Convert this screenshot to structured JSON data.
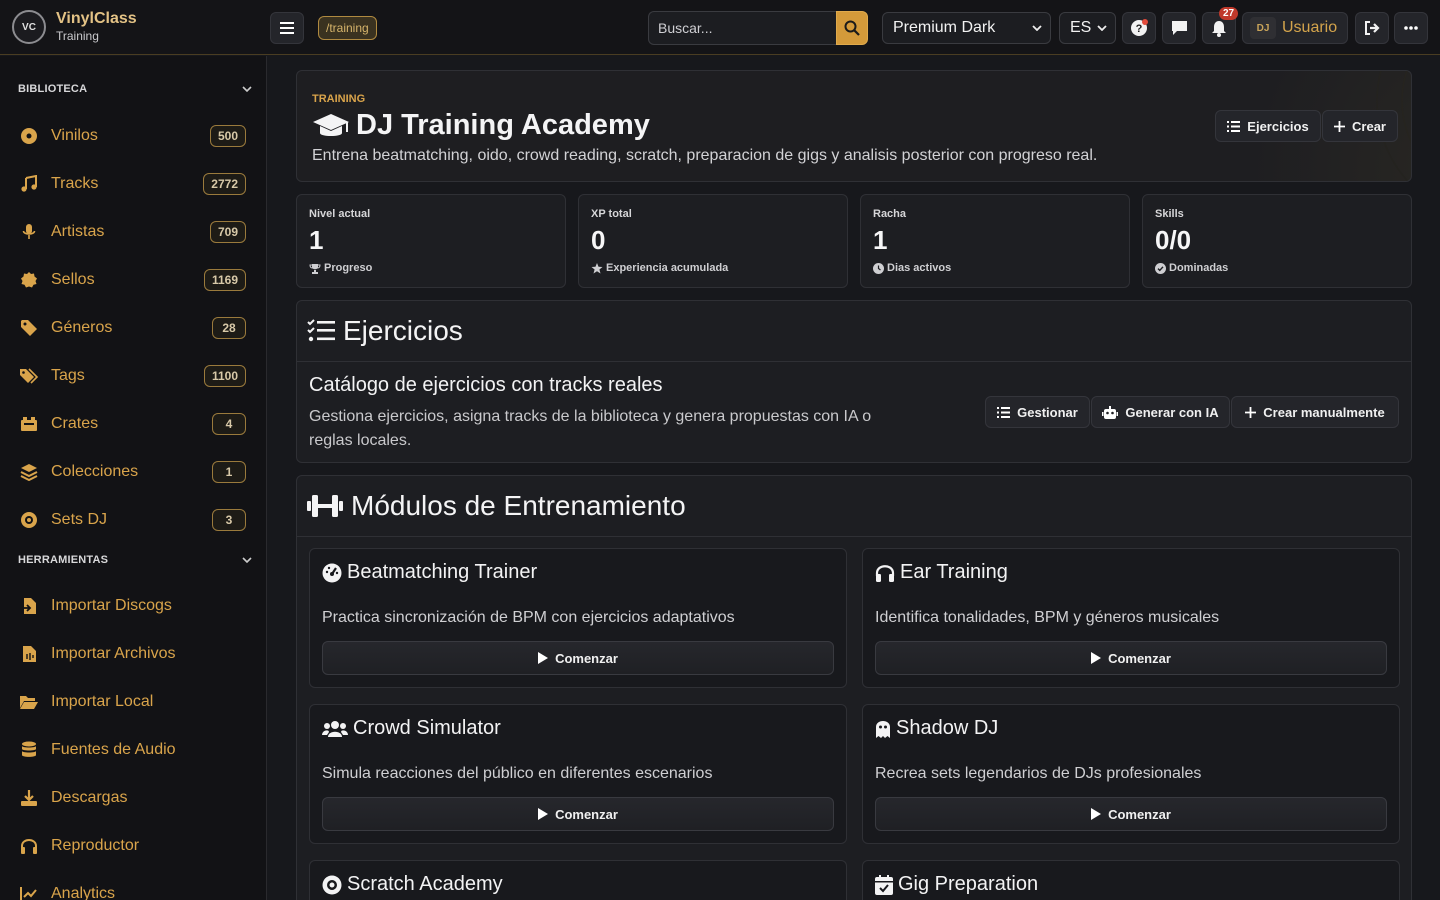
{
  "app": {
    "logo_text": "VC",
    "name": "VinylClass",
    "subtitle": "Training"
  },
  "topbar": {
    "route": "/training",
    "search_placeholder": "Buscar...",
    "theme": "Premium Dark",
    "language": "ES",
    "notifications_count": "27",
    "user_avatar": "DJ",
    "user_name": "Usuario"
  },
  "sidebar": {
    "library_title": "BIBLIOTECA",
    "library_items": [
      {
        "label": "Vinilos",
        "count": "500",
        "icon": "disc-icon"
      },
      {
        "label": "Tracks",
        "count": "2772",
        "icon": "music-note-icon"
      },
      {
        "label": "Artistas",
        "count": "709",
        "icon": "microphone-icon"
      },
      {
        "label": "Sellos",
        "count": "1169",
        "icon": "seal-icon"
      },
      {
        "label": "Géneros",
        "count": "28",
        "icon": "tag-icon"
      },
      {
        "label": "Tags",
        "count": "1100",
        "icon": "tags-icon"
      },
      {
        "label": "Crates",
        "count": "4",
        "icon": "crate-icon"
      },
      {
        "label": "Colecciones",
        "count": "1",
        "icon": "layers-icon"
      },
      {
        "label": "Sets DJ",
        "count": "3",
        "icon": "record-icon"
      }
    ],
    "tools_title": "HERRAMIENTAS",
    "tools_items": [
      {
        "label": "Importar Discogs",
        "icon": "file-import-icon"
      },
      {
        "label": "Importar Archivos",
        "icon": "file-audio-icon"
      },
      {
        "label": "Importar Local",
        "icon": "folder-open-icon"
      },
      {
        "label": "Fuentes de Audio",
        "icon": "database-icon"
      },
      {
        "label": "Descargas",
        "icon": "download-icon"
      },
      {
        "label": "Reproductor",
        "icon": "headphones-icon"
      },
      {
        "label": "Analytics",
        "icon": "chart-line-icon"
      }
    ]
  },
  "hero": {
    "kicker": "TRAINING",
    "title": "DJ Training Academy",
    "description": "Entrena beatmatching, oido, crowd reading, scratch, preparacion de gigs y analisis posterior con progreso real.",
    "exercises_button": "Ejercicios",
    "create_button": "Crear"
  },
  "stats": [
    {
      "label": "Nivel actual",
      "value": "1",
      "sub": "Progreso"
    },
    {
      "label": "XP total",
      "value": "0",
      "sub": "Experiencia acumulada"
    },
    {
      "label": "Racha",
      "value": "1",
      "sub": "Dias activos"
    },
    {
      "label": "Skills",
      "value": "0/0",
      "sub": "Dominadas"
    }
  ],
  "exercises": {
    "title": "Ejercicios",
    "catalog_title": "Catálogo de ejercicios con tracks reales",
    "catalog_desc_1": "Gestiona ejercicios, asigna tracks de la biblioteca y genera propuestas con IA o",
    "catalog_desc_2": "reglas locales.",
    "manage_button": "Gestionar",
    "ai_button": "Generar con IA",
    "manual_button": "Crear manualmente"
  },
  "modules": {
    "title": "Módulos de Entrenamiento",
    "start_label": "Comenzar",
    "items": [
      {
        "title": "Beatmatching Trainer",
        "desc": "Practica sincronización de BPM con ejercicios adaptativos"
      },
      {
        "title": "Ear Training",
        "desc": "Identifica tonalidades, BPM y géneros musicales"
      },
      {
        "title": "Crowd Simulator",
        "desc": "Simula reacciones del público en diferentes escenarios"
      },
      {
        "title": "Shadow DJ",
        "desc": "Recrea sets legendarios de DJs profesionales"
      },
      {
        "title": "Scratch Academy",
        "desc": ""
      },
      {
        "title": "Gig Preparation",
        "desc": ""
      }
    ]
  },
  "colors": {
    "accent": "#d9a44b",
    "background": "#17181c",
    "card": "#1d1e22",
    "border": "#2f3035"
  }
}
